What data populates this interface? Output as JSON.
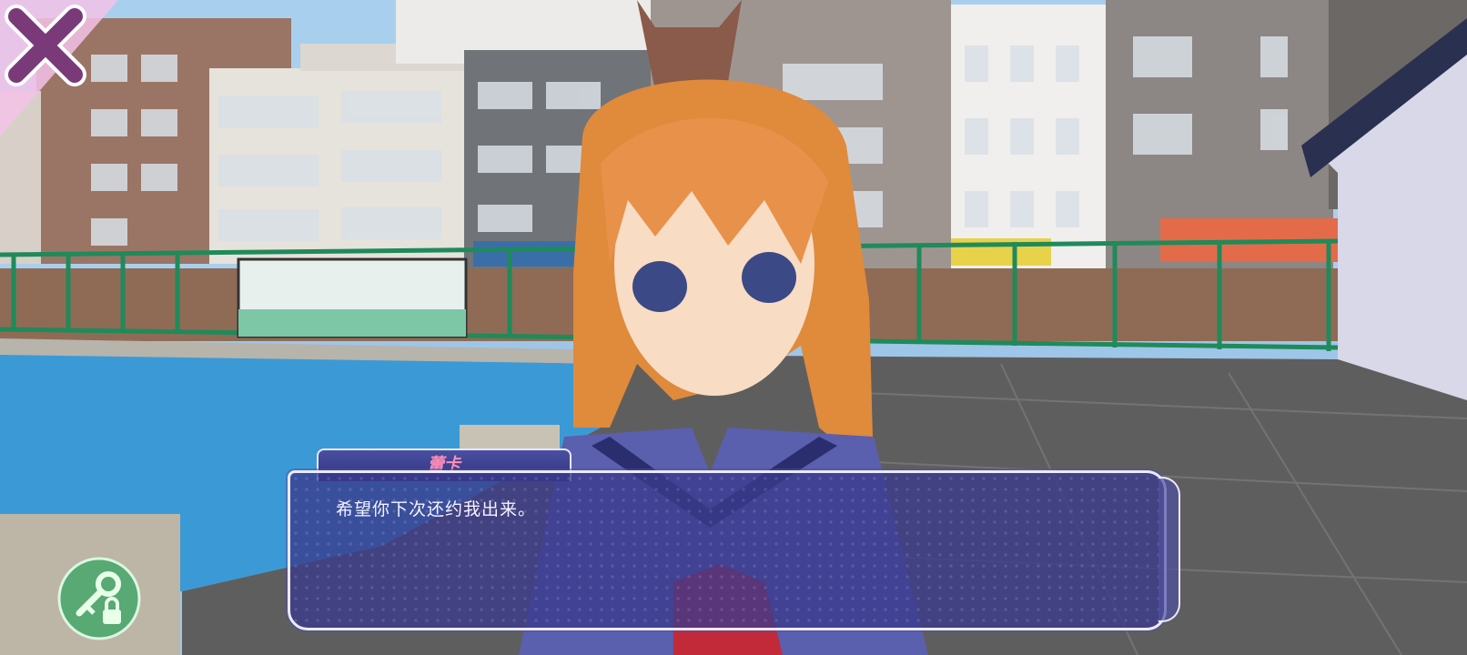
{
  "dialog": {
    "speaker_name": "蕾卡",
    "text": "希望你下次还约我出来。"
  },
  "icons": {
    "close": "close-x-icon",
    "key_lock": "key-lock-icon"
  },
  "colors": {
    "dialog_bg": "#3a3a8c",
    "speaker_name": "#ff8fb8",
    "close_icon": "#7a3a7a",
    "key_button": "#4ea86e"
  }
}
